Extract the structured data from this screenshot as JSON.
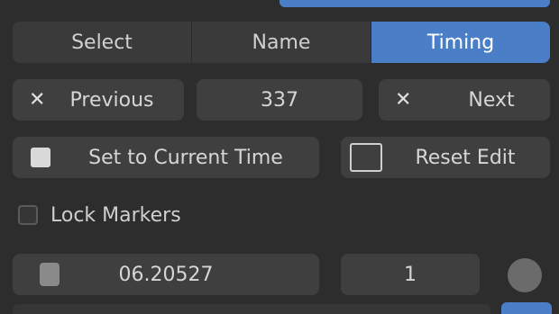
{
  "segmented": {
    "tabs": [
      {
        "label": "Select",
        "active": false
      },
      {
        "label": "Name",
        "active": false
      },
      {
        "label": "Timing",
        "active": true
      }
    ]
  },
  "row2": {
    "left_label": "Previous",
    "center_value": "337",
    "right_label": "Next"
  },
  "row3": {
    "set_current_label": "Set to Current Time",
    "reset_label": "Reset Edit"
  },
  "lock": {
    "label": "Lock Markers"
  },
  "row5": {
    "time_value": "06.20527",
    "step_value": "1"
  },
  "colors": {
    "accent": "#4a7fc8",
    "panel": "#2d2d2d",
    "button": "#3f3f3f"
  }
}
